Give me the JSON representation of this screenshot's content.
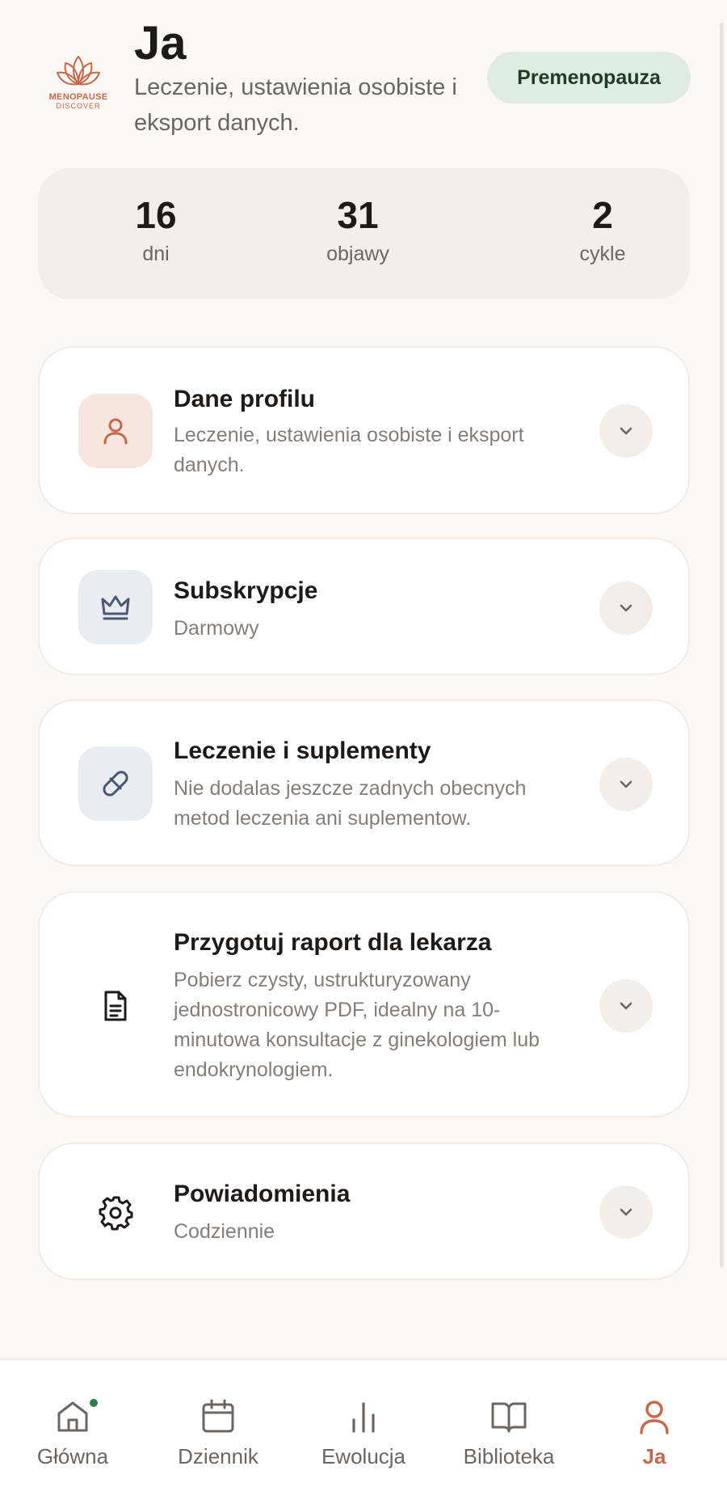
{
  "header": {
    "logo_word": "MENOPAUSE",
    "logo_sub": "DISCOVER",
    "title": "Ja",
    "subtitle": "Leczenie, ustawienia osobiste i eksport danych.",
    "phase_badge": "Premenopauza"
  },
  "stats": [
    {
      "value": "16",
      "label": "dni"
    },
    {
      "value": "31",
      "label": "objawy"
    },
    {
      "value": "2",
      "label": "cykle"
    }
  ],
  "cards": {
    "profile": {
      "title": "Dane profilu",
      "desc": "Leczenie, ustawienia osobiste i eksport danych.",
      "icon": "user-icon"
    },
    "subscription": {
      "title": "Subskrypcje",
      "desc": "Darmowy",
      "icon": "crown-icon"
    },
    "treatment": {
      "title": "Leczenie i suplementy",
      "desc": "Nie dodalas jeszcze zadnych obecnych metod leczenia ani suplementow.",
      "icon": "pill-icon"
    },
    "report": {
      "title": "Przygotuj raport dla lekarza",
      "desc": "Pobierz czysty, ustrukturyzowany jednostronicowy PDF, idealny na 10-minutowa konsultacje z ginekologiem lub endokrynologiem.",
      "icon": "document-icon"
    },
    "notifications": {
      "title": "Powiadomienia",
      "desc": "Codziennie",
      "icon": "gear-icon"
    }
  },
  "nav": {
    "home": "Główna",
    "journal": "Dziennik",
    "evolution": "Ewolucja",
    "library": "Biblioteka",
    "me": "Ja"
  },
  "colors": {
    "accent": "#C6694A",
    "badge_bg": "#DFEDE1",
    "badge_text": "#1F3B27",
    "notification_dot": "#2F7D4A"
  }
}
